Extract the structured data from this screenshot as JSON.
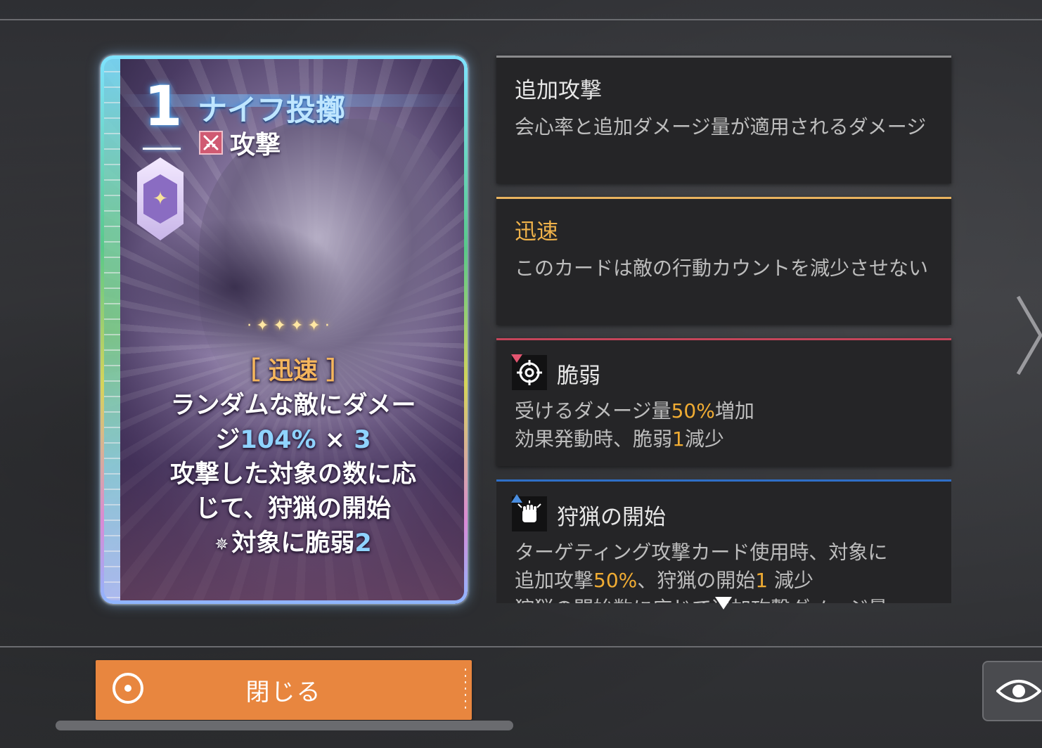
{
  "card": {
    "cost": "1",
    "title": "ナイフ投擲",
    "type_label": "攻撃",
    "keyword": "［ 迅速 ］",
    "line1": "ランダムな敵にダメー",
    "line2_prefix": "ジ",
    "line2_percent": "104%",
    "line2_times": " × ",
    "line2_count": "3",
    "line3": "攻撃した対象の数に応",
    "line4": "じて、狩猟の開始",
    "line5_prefix": "対象に脆弱",
    "line5_num": "2"
  },
  "panels": [
    {
      "title": "追加攻撃",
      "accent": "#8a8a8c",
      "desc": "会心率と追加ダメージ量が適用されるダメージ"
    },
    {
      "title": "迅速",
      "accent": "#e9b35f",
      "title_color": "#f0b24a",
      "desc": "このカードは敵の行動カウントを減少させない"
    },
    {
      "title": "脆弱",
      "accent": "#c5455a",
      "icon": "crosshair-icon",
      "desc1_a": "受けるダメージ量",
      "desc1_b": "50%",
      "desc1_c": "増加",
      "desc2_a": "効果発動時、脆弱",
      "desc2_b": "1",
      "desc2_c": "減少"
    },
    {
      "title": "狩猟の開始",
      "accent": "#2f6fc8",
      "icon": "fist-icon",
      "desc1": "ターゲティング攻撃カード使用時、対象に",
      "desc2_a": "追加攻撃",
      "desc2_b": "50%",
      "desc2_c": "、狩猟の開始",
      "desc2_d": "1",
      "desc2_e": " 減少",
      "desc3": "狩猟の開始数に応じて追加攻撃ダメージ量"
    }
  ],
  "buttons": {
    "close_label": "閉じる"
  },
  "icons": {
    "close": "record-circle-icon",
    "eye": "eye-icon",
    "next": "chevron-right-icon",
    "scroll_down": "caret-down-icon"
  }
}
